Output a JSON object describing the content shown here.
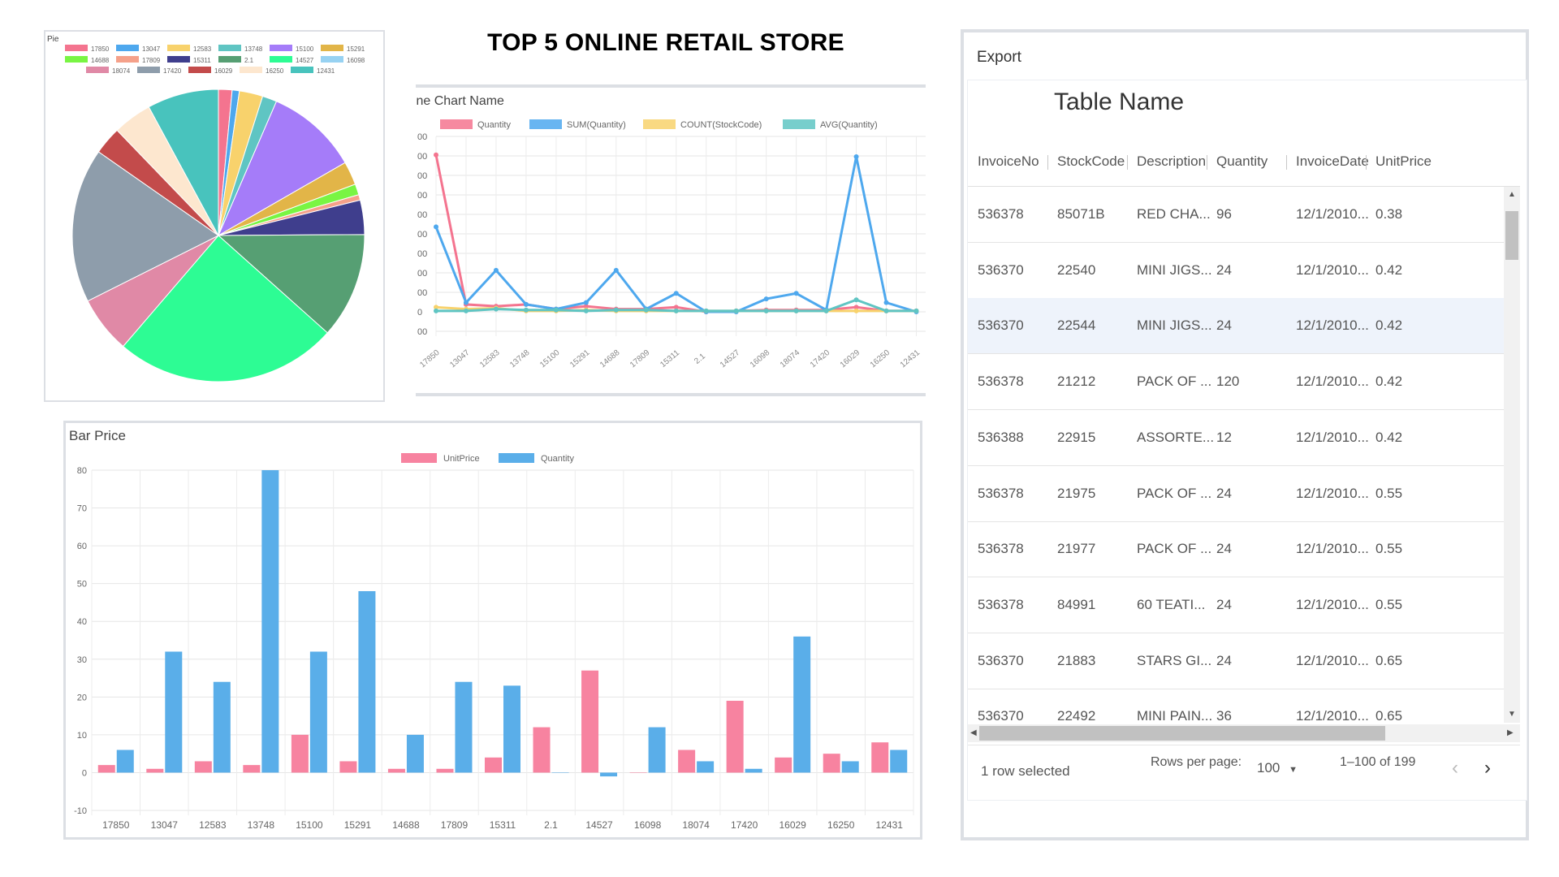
{
  "page_title": "TOP 5 ONLINE RETAIL STORE",
  "pie": {
    "title": "Pie",
    "chart_data": {
      "type": "pie",
      "title": "Pie",
      "labels": [
        "17850",
        "13047",
        "12583",
        "13748",
        "15100",
        "15291",
        "14688",
        "17809",
        "15311",
        "2.1",
        "14527",
        "16098",
        "18074",
        "17420",
        "16029",
        "16250",
        "12431"
      ],
      "colors": [
        "#f4748f",
        "#4ea8ee",
        "#f8d26c",
        "#5fc5c3",
        "#a57cf9",
        "#e2b548",
        "#79f543",
        "#f5a18a",
        "#3f3e8d",
        "#569f73",
        "#2dfc94",
        "#97d2f2",
        "#e089a6",
        "#8e9dab",
        "#c34b4b",
        "#fde7cf",
        "#48c3bd"
      ],
      "values": [
        1.5,
        0.8,
        2.6,
        1.6,
        10.2,
        2.6,
        1.2,
        0.6,
        3.8,
        11.7,
        24.7,
        0.0,
        6.3,
        17.1,
        3.1,
        4.3,
        7.9
      ]
    }
  },
  "line": {
    "title": "Line Chart Name",
    "chart_data": {
      "type": "line",
      "title": "Line Chart Name",
      "categories": [
        "17850",
        "13047",
        "12583",
        "13748",
        "15100",
        "15291",
        "14688",
        "17809",
        "15311",
        "2.1",
        "14527",
        "16098",
        "18074",
        "17420",
        "16029",
        "16250",
        "12431"
      ],
      "y_tick_labels": [
        "00",
        "00",
        "00",
        "00",
        "00",
        "00",
        "00",
        "00",
        "00",
        "0",
        "00"
      ],
      "series": [
        {
          "name": "Quantity",
          "color": "#f4748f",
          "values": [
            170,
            8,
            6,
            8,
            3,
            6,
            3,
            3,
            5,
            0,
            1,
            2,
            2,
            2,
            5,
            1,
            1
          ]
        },
        {
          "name": "SUM(Quantity)",
          "color": "#4ea8ee",
          "values": [
            92,
            10,
            45,
            8,
            3,
            10,
            45,
            3,
            20,
            0,
            0,
            14,
            20,
            2,
            168,
            10,
            0
          ]
        },
        {
          "name": "COUNT(StockCode)",
          "color": "#f8d26c",
          "values": [
            5,
            3,
            4,
            1,
            1,
            2,
            1,
            1,
            1,
            1,
            1,
            1,
            1,
            1,
            1,
            1,
            1
          ]
        },
        {
          "name": "AVG(Quantity)",
          "color": "#5fc5c3",
          "values": [
            1,
            1,
            3,
            2,
            2,
            1,
            2,
            2,
            1,
            1,
            1,
            1,
            1,
            1,
            13,
            1,
            1
          ]
        }
      ]
    }
  },
  "bar": {
    "title": "Bar Price",
    "chart_data": {
      "type": "bar",
      "title": "Bar Price",
      "categories": [
        "17850",
        "13047",
        "12583",
        "13748",
        "15100",
        "15291",
        "14688",
        "17809",
        "15311",
        "2.1",
        "14527",
        "16098",
        "18074",
        "17420",
        "16029",
        "16250",
        "12431"
      ],
      "ylim": [
        -10,
        80
      ],
      "y_ticks": [
        -10,
        0,
        10,
        20,
        30,
        40,
        50,
        60,
        70,
        80
      ],
      "grid": true,
      "legend_position": "top",
      "series": [
        {
          "name": "UnitPrice",
          "color": "#f783a0",
          "values": [
            2,
            1,
            3,
            2,
            10,
            3,
            1,
            1,
            4,
            12,
            27,
            0,
            6,
            19,
            4,
            5,
            8
          ]
        },
        {
          "name": "Quantity",
          "color": "#5aaee9",
          "values": [
            6,
            32,
            24,
            80,
            32,
            48,
            10,
            24,
            23,
            0,
            -1,
            12,
            3,
            1,
            36,
            3,
            6
          ]
        }
      ]
    }
  },
  "table": {
    "export_label": "Export",
    "name": "Table Name",
    "columns": [
      "InvoiceNo",
      "StockCode",
      "Description",
      "Quantity",
      "InvoiceDate",
      "UnitPrice"
    ],
    "rows": [
      [
        "536378",
        "85071B",
        "RED CHA...",
        "96",
        "12/1/2010...",
        "0.38"
      ],
      [
        "536370",
        "22540",
        "MINI JIGS...",
        "24",
        "12/1/2010...",
        "0.42"
      ],
      [
        "536370",
        "22544",
        "MINI JIGS...",
        "24",
        "12/1/2010...",
        "0.42"
      ],
      [
        "536378",
        "21212",
        "PACK OF ...",
        "120",
        "12/1/2010...",
        "0.42"
      ],
      [
        "536388",
        "22915",
        "ASSORTE...",
        "12",
        "12/1/2010...",
        "0.42"
      ],
      [
        "536378",
        "21975",
        "PACK OF ...",
        "24",
        "12/1/2010...",
        "0.55"
      ],
      [
        "536378",
        "21977",
        "PACK OF ...",
        "24",
        "12/1/2010...",
        "0.55"
      ],
      [
        "536378",
        "84991",
        "60 TEATI...",
        "24",
        "12/1/2010...",
        "0.55"
      ],
      [
        "536370",
        "21883",
        "STARS GI...",
        "24",
        "12/1/2010...",
        "0.65"
      ],
      [
        "536370",
        "22492",
        "MINI PAIN...",
        "36",
        "12/1/2010...",
        "0.65"
      ]
    ],
    "selected_row_index": 2,
    "footer": {
      "selected_text": "1 row selected",
      "rows_per_page_label": "Rows per page:",
      "rows_per_page_value": "100",
      "range_text": "1–100 of 199"
    }
  }
}
